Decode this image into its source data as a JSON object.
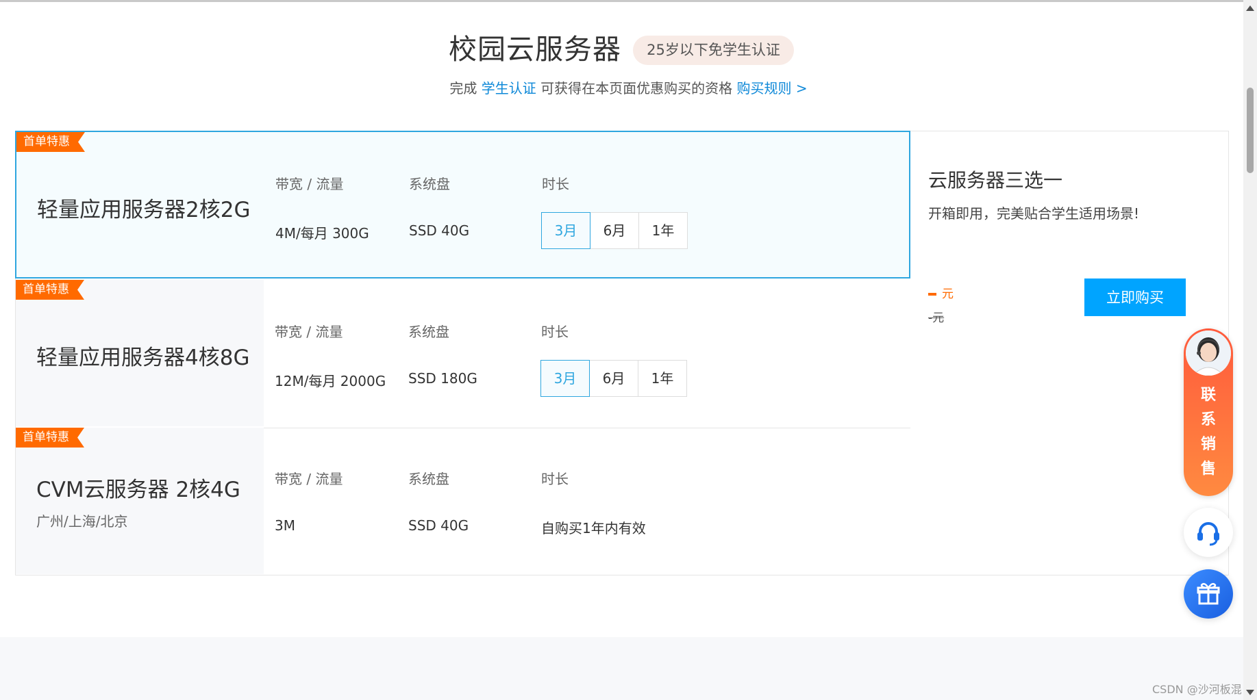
{
  "header": {
    "title": "校园云服务器",
    "badge": "25岁以下免学生认证",
    "subtitle_prefix": "完成 ",
    "subtitle_link": "学生认证",
    "subtitle_middle": " 可获得在本页面优惠购买的资格 ",
    "rules_link": "购买规则 >"
  },
  "labels": {
    "ribbon": "首单特惠",
    "bandwidth": "带宽 / 流量",
    "disk": "系统盘",
    "duration": "时长"
  },
  "products": [
    {
      "name": "轻量应用服务器2核2G",
      "bandwidth": "4M/每月 300G",
      "disk": "SSD 40G",
      "durations": [
        "3月",
        "6月",
        "1年"
      ],
      "selected_duration": "3月"
    },
    {
      "name": "轻量应用服务器4核8G",
      "bandwidth": "12M/每月 2000G",
      "disk": "SSD 180G",
      "durations": [
        "3月",
        "6月",
        "1年"
      ],
      "selected_duration": "3月"
    },
    {
      "name": "CVM云服务器 2核4G",
      "region": "广州/上海/北京",
      "bandwidth": "3M",
      "disk": "SSD 40G",
      "duration_text": "自购买1年内有效"
    }
  ],
  "right_panel": {
    "title": "云服务器三选一",
    "desc": "开箱即用，完美贴合学生适用场景!",
    "price_unit": "元",
    "orig_price": "-元",
    "buy_label": "立即购买"
  },
  "widgets": {
    "sales_label_chars": [
      "联",
      "系",
      "销",
      "售"
    ]
  },
  "watermark": "CSDN @沙河板混",
  "colors": {
    "accent_blue": "#00a4ff",
    "link_blue": "#0d88d8",
    "orange": "#ff6a00",
    "selected_border": "#2ea6df"
  }
}
